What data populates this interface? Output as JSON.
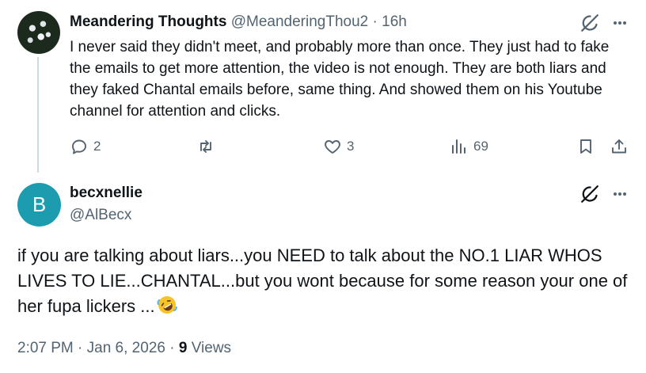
{
  "parent_post": {
    "display_name": "Meandering Thoughts",
    "handle": "@MeanderingThou2",
    "separator": "·",
    "time": "16h",
    "text": "I never said they didn't meet, and probably more than once. They just had to fake the emails to get more attention, the video is not enough. They are both liars and they faked Chantal emails before, same thing. And showed them on his Youtube channel for attention and clicks.",
    "replies": "2",
    "reposts": "",
    "likes": "3",
    "views": "69"
  },
  "reply_post": {
    "avatar_letter": "B",
    "display_name": "becxnellie",
    "handle": "@AlBecx",
    "text": "if you are talking about liars...you NEED to talk about the NO.1 LIAR WHOS LIVES TO LIE...CHANTAL...but you wont because for some reason your one of her fupa lickers ...",
    "emoji": "rolling-on-floor-laughing-emoji",
    "timestamp": "2:07 PM · Jan 6, 2026",
    "meta_sep": "·",
    "views_count": "9",
    "views_label": "Views"
  },
  "colors": {
    "text_primary": "#0f1419",
    "text_secondary": "#536471",
    "thread_line": "#cfd9de",
    "avatar_b": "#1d9cb0"
  },
  "icons": {
    "reply": "reply-icon",
    "repost": "repost-icon",
    "like": "heart-icon",
    "views": "analytics-icon",
    "bookmark": "bookmark-icon",
    "share": "share-icon",
    "grok": "grok-icon",
    "more": "more-icon"
  }
}
